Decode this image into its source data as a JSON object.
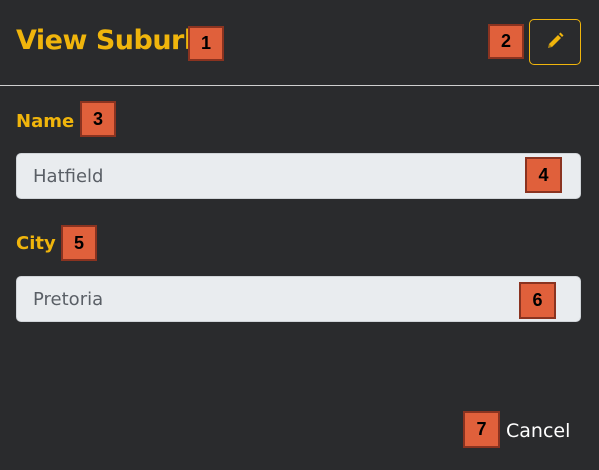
{
  "header": {
    "title": "View Suburb",
    "edit_icon": "pencil-icon"
  },
  "form": {
    "name_label": "Name",
    "name_value": "Hatfield",
    "city_label": "City",
    "city_value": "Pretoria"
  },
  "footer": {
    "cancel_label": "Cancel"
  },
  "markers": [
    "1",
    "2",
    "3",
    "4",
    "5",
    "6",
    "7"
  ],
  "colors": {
    "background": "#2a2b2d",
    "accent": "#f0b50c",
    "field_bg": "#e9ecef",
    "marker": "#e0603b"
  }
}
